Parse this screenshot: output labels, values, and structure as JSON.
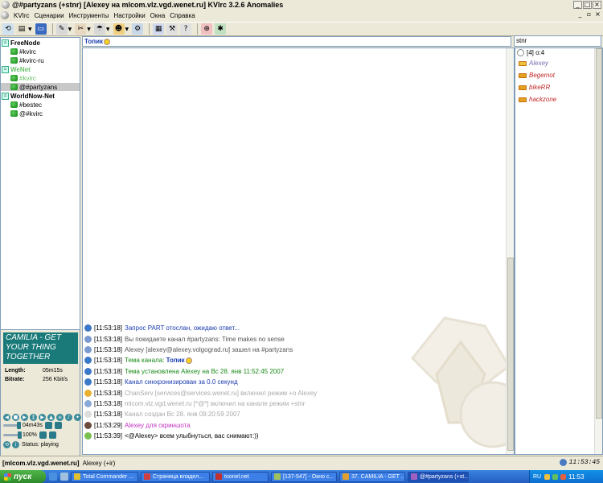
{
  "window": {
    "title": "@#partyzans (+stnr) [Alexey на mlcom.vlz.vgd.wenet.ru] KVIrc 3.2.6 Anomalies"
  },
  "menu": {
    "items": [
      "KVIrc",
      "Сценарии",
      "Инструменты",
      "Настройки",
      "Окна",
      "Справка"
    ]
  },
  "tree": {
    "networks": [
      {
        "name": "FreeNode",
        "color": "#000000",
        "channels": [
          {
            "name": "#kvirc"
          },
          {
            "name": "#kvirc-ru"
          }
        ]
      },
      {
        "name": "WeNet",
        "color": "#6ac06a",
        "channels": [
          {
            "name": "#kvirc",
            "color": "#6ac06a"
          },
          {
            "name": "@#partyzans",
            "selected": true
          }
        ]
      },
      {
        "name": "WorldNow-Net",
        "color": "#000000",
        "channels": [
          {
            "name": "#bestec"
          },
          {
            "name": "@#kvirc"
          }
        ]
      }
    ]
  },
  "player": {
    "title": "CAMILIA - GET YOUR THING TOGETHER",
    "length_label": "Length:",
    "length_value": "05m15s",
    "bitrate_label": "Bitrate:",
    "bitrate_value": "256 Kbit/s",
    "position": "04m43s",
    "volume": "100%",
    "status": "Status: playing"
  },
  "topic": {
    "label": "Топик"
  },
  "messages": [
    {
      "ts": "[11:53:18]",
      "text": "Запрос PART отослан, ожидаю ответ...",
      "color": "#1a3cb0",
      "icon": "#3a78c8"
    },
    {
      "ts": "[11:53:18]",
      "text": "Вы покидаете канал #partyzans: Time makes no sense",
      "color": "#555555",
      "icon": "#7a9ad0"
    },
    {
      "ts": "[11:53:18]",
      "text": "Alexey [alexey@alexey.volgograd.ru] зашел на #partyzans",
      "color": "#555555",
      "icon": "#7a9ad0"
    },
    {
      "ts": "[11:53:18]",
      "text": "Тема канала: ",
      "color": "#1a8a1a",
      "icon": "#3a78c8",
      "bold": "Топик",
      "smile": true
    },
    {
      "ts": "[11:53:18]",
      "text": "Тема установлена Alexey на Вс 28. янв 11:52:45 2007",
      "color": "#1a8a1a",
      "icon": "#3a78c8"
    },
    {
      "ts": "[11:53:18]",
      "text": "Канал синхронизирован за 0.0 секунд",
      "color": "#1a3cb0",
      "icon": "#3a78c8"
    },
    {
      "ts": "[11:53:18]",
      "text": "ChanServ [services@services.wenet.ru] включил режим +o Alexey",
      "color": "#aaaaaa",
      "icon": "#e8b030"
    },
    {
      "ts": "[11:53:18]",
      "text": "mlcom.vlz.vgd.wenet.ru [*@*] включил на канале режим +stnr",
      "color": "#aaaaaa",
      "icon": "#88a8d8"
    },
    {
      "ts": "[11:53:18]",
      "text": "Канал создан Вс 28. янв 09:20:59 2007",
      "color": "#aaaaaa",
      "icon": "#dddddd"
    },
    {
      "ts": "[11:53:29]",
      "text": "Alexey для скриншота",
      "color": "#c030c0",
      "icon": "#6a4a3a"
    },
    {
      "ts": "[11:53:39]",
      "text": "<@Alexey> всем улыбнуться, вас снимают:))",
      "color": "#000000",
      "icon": "#78c050"
    }
  ],
  "users": {
    "search": "stnr",
    "count": "[4] o:4",
    "list": [
      {
        "name": "Alexey",
        "color": "#7a6ab0",
        "op": true
      },
      {
        "name": "Begemot",
        "color": "#c02828",
        "op": false
      },
      {
        "name": "bikeRR",
        "color": "#c02828",
        "op": false
      },
      {
        "name": "hackzone",
        "color": "#c02828",
        "op": false
      }
    ]
  },
  "statusbar": {
    "server": "[mlcom.vlz.vgd.wenet.ru]",
    "nick": "Alexey (+ir)",
    "clock": "11:53:45"
  },
  "taskbar": {
    "start": "пуск",
    "tasks": [
      {
        "label": "Total Commander ...",
        "icon": "#e0c030"
      },
      {
        "label": "Страница владел...",
        "icon": "#d04040"
      },
      {
        "label": "toonel.net",
        "icon": "#c03030"
      },
      {
        "label": "[137-547] - Окно с...",
        "icon": "#a0c060"
      },
      {
        "label": "37. CAMILIA - GET ...",
        "icon": "#e0a030"
      },
      {
        "label": "@#partyzans (+st...",
        "icon": "#a060c0",
        "active": true
      }
    ],
    "lang": "RU",
    "time": "11:53"
  }
}
